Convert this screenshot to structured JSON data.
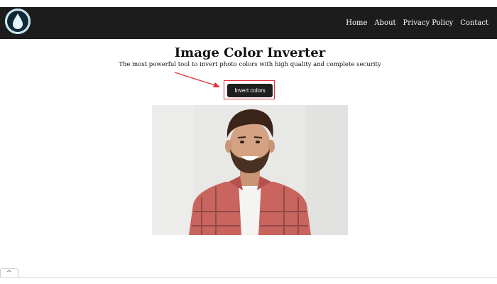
{
  "nav": {
    "logo_icon": "water-drop-icon",
    "links": [
      "Home",
      "About",
      "Privacy Policy",
      "Contact"
    ]
  },
  "main": {
    "title": "Image Color Inverter",
    "subtitle": "The most powerful tool to invert photo colors with high quality and complete security",
    "button_label": "Invert colors"
  },
  "footer": {
    "scroll_icon": "chevron-up-icon",
    "scroll_glyph": "^"
  },
  "colors": {
    "navbar": "#1c1c1c",
    "button": "#1f1f1f",
    "annotation": "#e0303a"
  }
}
